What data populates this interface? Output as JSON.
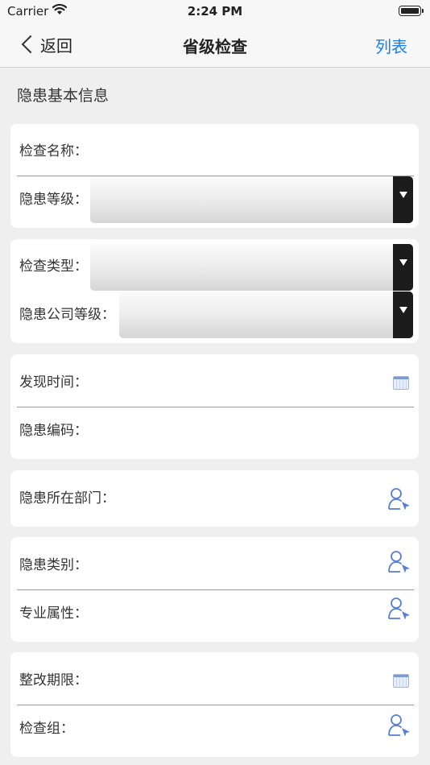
{
  "statusbar": {
    "carrier": "Carrier",
    "time": "2:24 PM"
  },
  "navbar": {
    "back_label": "返回",
    "title": "省级检查",
    "right_label": "列表"
  },
  "section": {
    "title": "隐患基本信息"
  },
  "fields": {
    "check_name": "检查名称：",
    "hazard_level": "隐患等级：",
    "check_type": "检查类型：",
    "company_hazard_level": "隐患公司等级：",
    "found_time": "发现时间：",
    "hazard_code": "隐患编码：",
    "department": "隐患所在部门：",
    "hazard_category": "隐患类别：",
    "specialty": "专业属性：",
    "rectify_deadline": "整改期限：",
    "check_group": "检查组："
  },
  "colors": {
    "accent": "#1a7df0",
    "icon": "#5a7fd6",
    "background": "#efefef"
  },
  "icons": {
    "calendar": "calendar-icon",
    "user_select": "user-select-icon",
    "back": "chevron-left-icon"
  }
}
